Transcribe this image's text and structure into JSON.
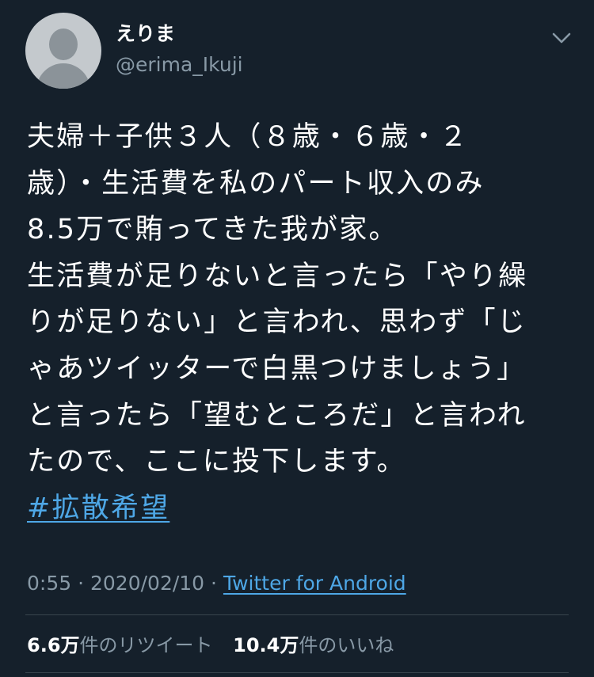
{
  "user": {
    "display_name": "えりま",
    "handle": "@erima_Ikuji"
  },
  "tweet": {
    "lines": [
      "夫婦＋子供３人（８歳・６歳・２",
      "歳）・生活費を私のパート収入のみ",
      "8.5万で賄ってきた我が家。",
      "生活費が足りないと言ったら「やり繰",
      "りが足りない」と言われ、思わず「じ",
      "ゃあツイッターで白黒つけましょう」",
      "と言ったら「望むところだ」と言われ",
      "たので、ここに投下します。"
    ],
    "hashtag": "#拡散希望"
  },
  "meta": {
    "time": "0:55",
    "separator": "·",
    "date": "2020/02/10",
    "source": "Twitter for Android"
  },
  "stats": {
    "retweets_count": "6.6万",
    "retweets_label": "件のリツイート",
    "likes_count": "10.4万",
    "likes_label": "件のいいね"
  },
  "colors": {
    "background": "#15202b",
    "secondary_text": "#8899a6",
    "link": "#4ea7e6",
    "divider": "#38444d"
  },
  "icons": {
    "more": "chevron-down-icon",
    "avatar": "default-avatar"
  }
}
